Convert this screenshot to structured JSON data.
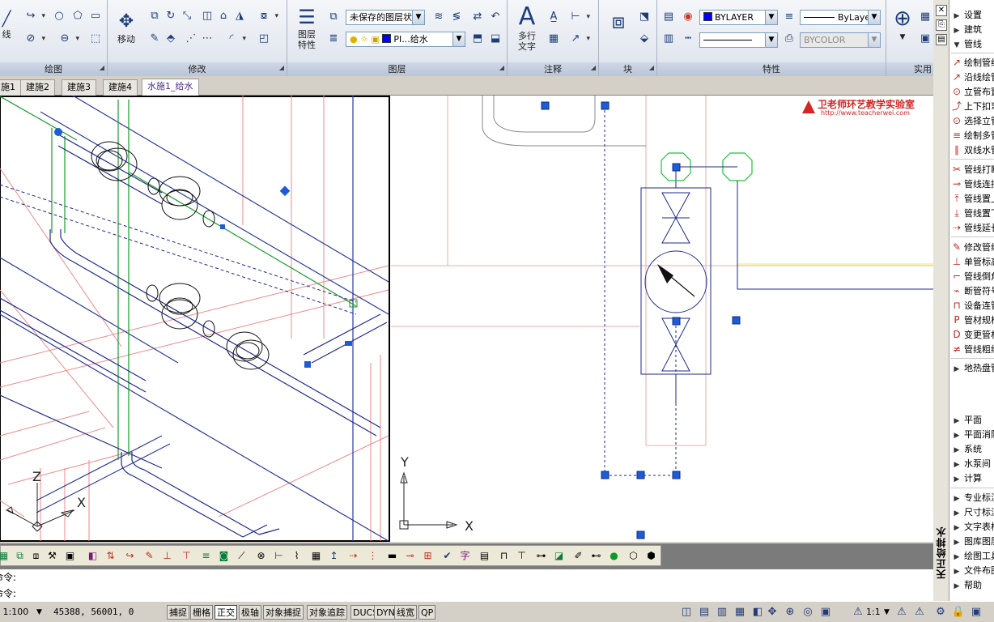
{
  "ribbon": {
    "panels": [
      {
        "name": "draw",
        "label": "绘图"
      },
      {
        "name": "modify",
        "label": "修改"
      },
      {
        "name": "layers",
        "label": "图层"
      },
      {
        "name": "annotation",
        "label": "注释"
      },
      {
        "name": "block",
        "label": "块"
      },
      {
        "name": "properties",
        "label": "特性"
      },
      {
        "name": "utilities",
        "label": "实用"
      }
    ],
    "draw_partial_label": "线",
    "move_label": "移动",
    "layer_props_label": "图层\n特性",
    "layer_props_line1": "图层",
    "layer_props_line2": "特性",
    "layer_state_combo": "未保存的图层状",
    "layer_combo": "PI...给水",
    "mtext_line1": "多行",
    "mtext_line2": "文字",
    "color_combo": "BYLAYER",
    "linetype_combo": "ByLayer",
    "lineweight_combo": "",
    "plotstyle_combo": "BYCOLOR",
    "colors": {
      "accent_blue": "#1c3d7a",
      "color_swatch": "#0000ff"
    }
  },
  "tabs": [
    {
      "label": "施1",
      "active": false
    },
    {
      "label": "建施2",
      "active": false
    },
    {
      "label": "建施3",
      "active": false
    },
    {
      "label": "建施4",
      "active": false
    },
    {
      "label": "水施1_给水",
      "active": true
    }
  ],
  "drawing": {
    "left_ucs": {
      "z": "Z",
      "x": "X"
    },
    "right_ucs": {
      "y": "Y",
      "x": "X"
    },
    "watermark_title": "卫老师环艺教学实验室",
    "watermark_url": "http://www.teacherwei.com"
  },
  "command": {
    "line1": "命令:",
    "line2": "命令:"
  },
  "status": {
    "scale": "比例 1:100",
    "coords": "45388, 56001, 0",
    "toggles": [
      {
        "label": "捕捉",
        "on": false
      },
      {
        "label": "栅格",
        "on": false
      },
      {
        "label": "正交",
        "on": true
      },
      {
        "label": "极轴",
        "on": false
      },
      {
        "label": "对象捕捉",
        "on": false
      },
      {
        "label": "对象追踪",
        "on": false
      },
      {
        "label": "DUCS",
        "on": false
      },
      {
        "label": "DYN",
        "on": false
      },
      {
        "label": "线宽",
        "on": false
      },
      {
        "label": "QP",
        "on": false
      }
    ],
    "anno_scale": "1:1"
  },
  "palette": {
    "title": "天正给排水",
    "top_items": [
      {
        "label": "设置"
      },
      {
        "label": "建筑"
      },
      {
        "label": "管线"
      }
    ],
    "tools_a": [
      {
        "label": "绘制管线",
        "icon": "↗"
      },
      {
        "label": "沿线绘管",
        "icon": "↗"
      },
      {
        "label": "立管布置",
        "icon": "⊙"
      },
      {
        "label": "上下扣弯",
        "icon": "⤴"
      },
      {
        "label": "选择立管",
        "icon": "⊙"
      },
      {
        "label": "绘制多管",
        "icon": "≡"
      },
      {
        "label": "双线水管",
        "icon": "∥"
      }
    ],
    "tools_b": [
      {
        "label": "管线打断",
        "icon": "✂"
      },
      {
        "label": "管线连接",
        "icon": "⊸"
      },
      {
        "label": "管线置上",
        "icon": "⤒"
      },
      {
        "label": "管线置下",
        "icon": "⤓"
      },
      {
        "label": "管线延长",
        "icon": "⇢"
      }
    ],
    "tools_c": [
      {
        "label": "修改管线",
        "icon": "✎"
      },
      {
        "label": "单管标高",
        "icon": "⊥"
      },
      {
        "label": "管线倒角",
        "icon": "⌐"
      },
      {
        "label": "断管符号",
        "icon": "⌁"
      },
      {
        "label": "设备连管",
        "icon": "⊓"
      },
      {
        "label": "管材规格",
        "icon": "P"
      },
      {
        "label": "变更管材",
        "icon": "D"
      },
      {
        "label": "管线粗细",
        "icon": "≠"
      }
    ],
    "tools_d": [
      {
        "label": "地热盘管"
      }
    ],
    "cat_items": [
      {
        "label": "平面"
      },
      {
        "label": "平面消防"
      },
      {
        "label": "系统"
      },
      {
        "label": "水泵间"
      },
      {
        "label": "计算"
      }
    ],
    "extra_items": [
      {
        "label": "专业标注"
      },
      {
        "label": "尺寸标注"
      },
      {
        "label": "文字表格"
      },
      {
        "label": "图库图层"
      },
      {
        "label": "绘图工具"
      },
      {
        "label": "文件布图"
      },
      {
        "label": "帮助"
      }
    ]
  }
}
